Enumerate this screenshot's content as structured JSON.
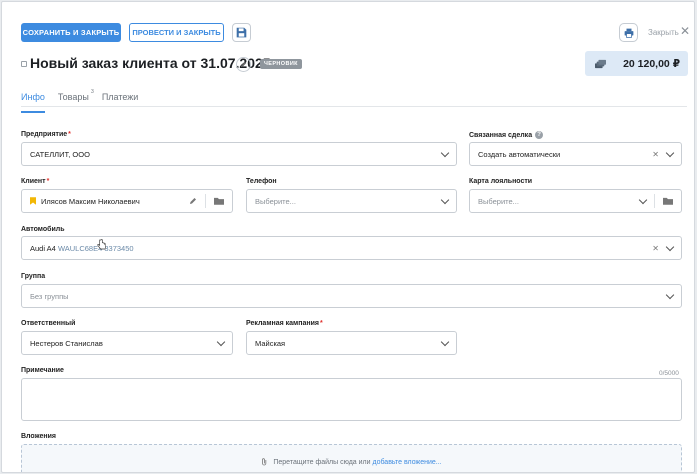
{
  "toolbar": {
    "save_close": "СОХРАНИТЬ И ЗАКРЫТЬ",
    "post_close": "ПРОВЕСТИ И ЗАКРЫТЬ",
    "save_icon": "floppy-disk-icon",
    "print_icon": "printer-icon",
    "close_label": "Закрыть",
    "close_icon": "close-x-icon"
  },
  "header": {
    "title": "Новый заказ клиента от 31.07.2025",
    "status_badge": "ЧЕРНОВИК",
    "total": "20 120,00 ₽",
    "total_icon": "cash-stack-icon"
  },
  "tabs": [
    {
      "label": "Инфо",
      "active": true,
      "badge": ""
    },
    {
      "label": "Товары",
      "active": false,
      "badge": "3"
    },
    {
      "label": "Платежи",
      "active": false,
      "badge": ""
    }
  ],
  "form": {
    "company": {
      "label": "Предприятие",
      "value": "САТЕЛЛИТ, ООО"
    },
    "related_deal": {
      "label": "Связанная сделка",
      "value": "Создать автоматически"
    },
    "client": {
      "label": "Клиент",
      "value": "Илясов Максим Николаевич"
    },
    "phone": {
      "label": "Телефон",
      "placeholder": "Выберите..."
    },
    "loyalty_card": {
      "label": "Карта лояльности",
      "placeholder": "Выберите..."
    },
    "vehicle": {
      "label": "Автомобиль",
      "model": "Audi A4",
      "vin": "WAULC68E4 3373450"
    },
    "group": {
      "label": "Группа",
      "placeholder": "Без группы"
    },
    "responsible": {
      "label": "Ответственный",
      "value": "Нестеров Станислав"
    },
    "ad_campaign": {
      "label": "Рекламная кампания",
      "value": "Майская"
    },
    "note": {
      "label": "Примечание",
      "counter": "0/5000"
    },
    "attachments": {
      "label": "Вложения",
      "drop_text": "Перетащите файлы сюда или",
      "drop_link": "добавьте вложение..."
    }
  },
  "colors": {
    "accent": "#3d8be0",
    "required": "#e0302c",
    "badge": "#8f969d",
    "total_bg": "#dde9f6"
  }
}
